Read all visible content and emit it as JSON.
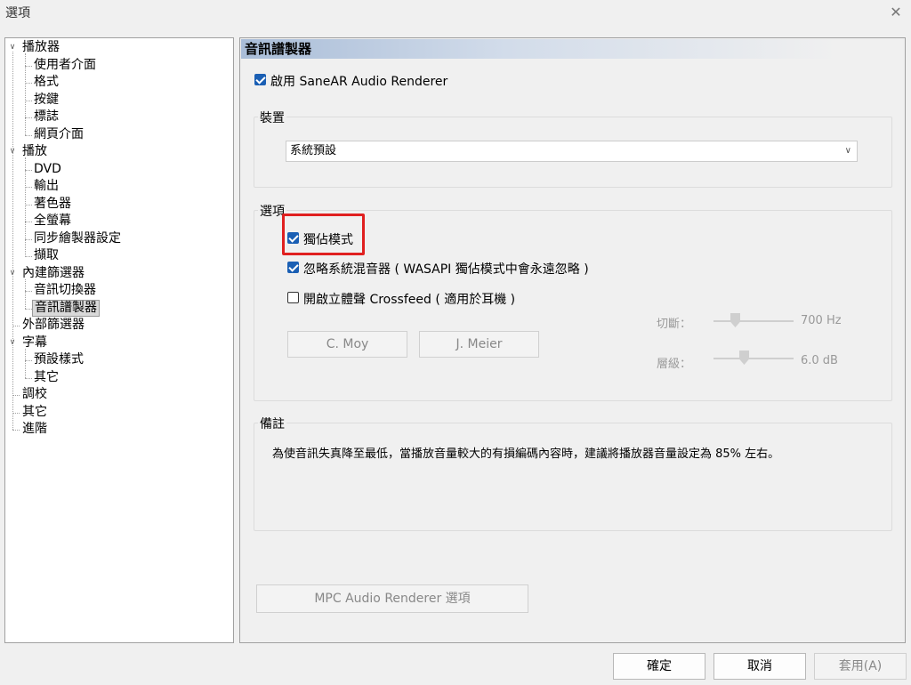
{
  "window": {
    "title": "選項",
    "close_glyph": "✕"
  },
  "tree": {
    "groups": [
      {
        "label": "播放器",
        "expanded": true,
        "children": [
          "使用者介面",
          "格式",
          "按鍵",
          "標誌",
          "網頁介面"
        ]
      },
      {
        "label": "播放",
        "expanded": true,
        "children": [
          "DVD",
          "輸出",
          "著色器",
          "全螢幕",
          "同步繪製器設定",
          "擷取"
        ]
      },
      {
        "label": "內建篩選器",
        "expanded": true,
        "children": [
          "音訊切換器",
          "音訊譜製器"
        ]
      },
      {
        "label": "外部篩選器",
        "expanded": false,
        "children": []
      },
      {
        "label": "字幕",
        "expanded": true,
        "children": [
          "預設樣式",
          "其它"
        ]
      },
      {
        "label": "調校",
        "expanded": false,
        "children": []
      },
      {
        "label": "其它",
        "expanded": false,
        "children": []
      },
      {
        "label": "進階",
        "expanded": false,
        "children": []
      }
    ],
    "selected": "音訊譜製器",
    "expander_glyph": "∨"
  },
  "panel": {
    "header": "音訊譜製器",
    "enable_label": "啟用 SaneAR Audio Renderer",
    "enable_checked": true,
    "device_group": {
      "title": "裝置",
      "selected": "系統預設"
    },
    "options_group": {
      "title": "選項",
      "exclusive_mode": {
        "label": "獨佔模式",
        "checked": true
      },
      "ignore_mixer": {
        "label": "忽略系統混音器 ( WASAPI 獨佔模式中會永遠忽略 )",
        "checked": true
      },
      "crossfeed": {
        "label": "開啟立體聲 Crossfeed ( 適用於耳機 )",
        "checked": false
      },
      "cmoy_label": "C. Moy",
      "jmeier_label": "J. Meier",
      "cutoff_label": "切斷：",
      "cutoff_value": "700 Hz",
      "level_label": "層級：",
      "level_value": "6.0 dB"
    },
    "notes_group": {
      "title": "備註",
      "text": "為使音訊失真降至最低，當播放音量較大的有損編碼內容時，建議將播放器音量設定為 85% 左右。"
    },
    "mpc_button": "MPC Audio Renderer 選項"
  },
  "footer": {
    "ok": "確定",
    "cancel": "取消",
    "apply": "套用(A)"
  }
}
